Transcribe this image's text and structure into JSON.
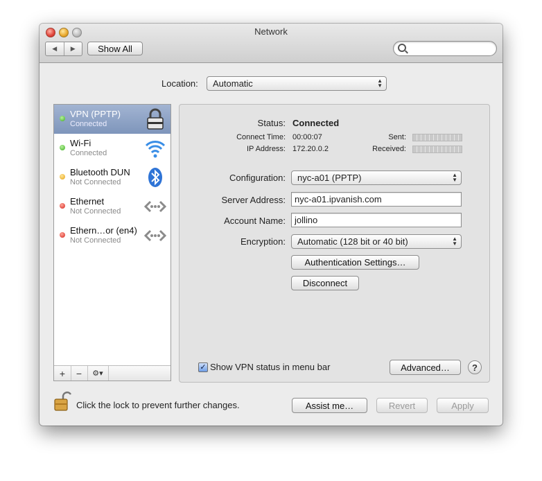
{
  "window": {
    "title": "Network"
  },
  "toolbar": {
    "back": "◀",
    "forward": "▶",
    "show_all": "Show All",
    "search_placeholder": ""
  },
  "location": {
    "label": "Location:",
    "value": "Automatic"
  },
  "sidebar": {
    "items": [
      {
        "name": "VPN (PPTP)",
        "status": "Connected",
        "dot": "green",
        "icon": "lock-icon"
      },
      {
        "name": "Wi-Fi",
        "status": "Connected",
        "dot": "green",
        "icon": "wifi-icon"
      },
      {
        "name": "Bluetooth DUN",
        "status": "Not Connected",
        "dot": "yellow",
        "icon": "bluetooth-icon"
      },
      {
        "name": "Ethernet",
        "status": "Not Connected",
        "dot": "red",
        "icon": "ethernet-icon"
      },
      {
        "name": "Ethern…or (en4)",
        "status": "Not Connected",
        "dot": "red",
        "icon": "ethernet-icon"
      }
    ],
    "add": "+",
    "remove": "−",
    "action": "⚙▾"
  },
  "details": {
    "status_label": "Status:",
    "status_value": "Connected",
    "connect_time_label": "Connect Time:",
    "connect_time_value": "00:00:07",
    "ip_label": "IP Address:",
    "ip_value": "172.20.0.2",
    "sent_label": "Sent:",
    "received_label": "Received:",
    "configuration_label": "Configuration:",
    "configuration_value": "nyc-a01 (PPTP)",
    "server_label": "Server Address:",
    "server_value": "nyc-a01.ipvanish.com",
    "account_label": "Account Name:",
    "account_value": "jollino",
    "encryption_label": "Encryption:",
    "encryption_value": "Automatic (128 bit or 40 bit)",
    "auth_button": "Authentication Settings…",
    "disconnect_button": "Disconnect",
    "show_vpn_label": "Show VPN status in menu bar",
    "show_vpn_checked": true,
    "advanced_button": "Advanced…",
    "help_button": "?"
  },
  "footer": {
    "lock_text": "Click the lock to prevent further changes.",
    "assist_button": "Assist me…",
    "revert_button": "Revert",
    "apply_button": "Apply"
  },
  "colors": {
    "selection": "#8ea2c6",
    "status_green": "#3bb01b",
    "status_yellow": "#e6a111",
    "status_red": "#d4221a"
  }
}
